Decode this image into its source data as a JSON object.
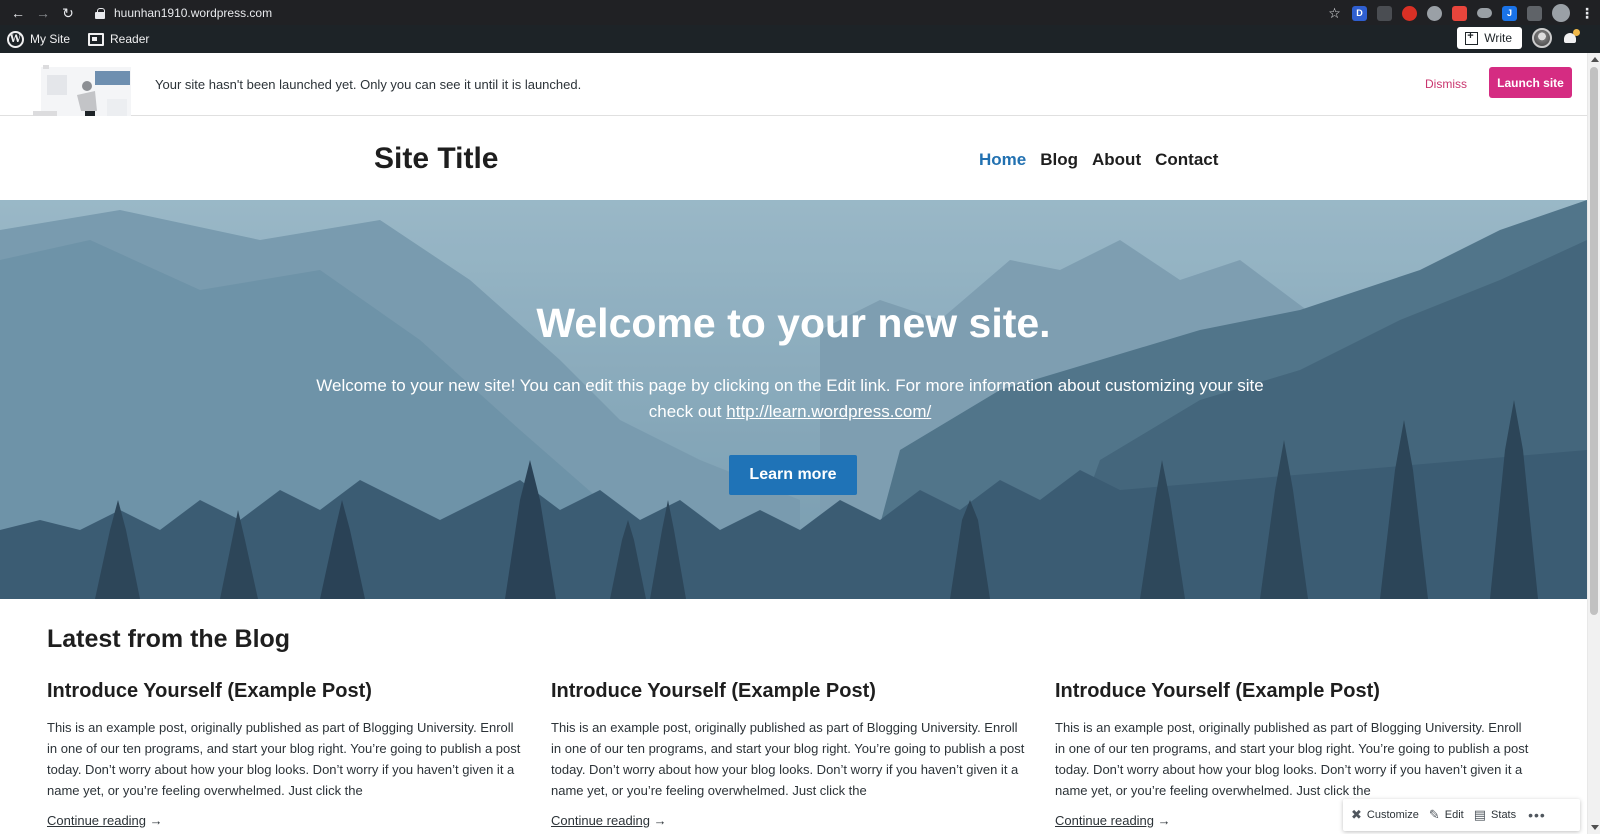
{
  "browser": {
    "url": "huunhan1910.wordpress.com",
    "extensions": [
      {
        "icon": "bookmark-star-icon"
      },
      {
        "icon": "extension-d-icon",
        "label": "D",
        "color": "#2f5fd0"
      },
      {
        "icon": "extension-grid-icon",
        "color": "#4a4d52"
      },
      {
        "icon": "extension-hand-icon",
        "color": "#d93025"
      },
      {
        "icon": "extension-swirl-icon",
        "color": "#9aa0a6"
      },
      {
        "icon": "extension-red-box-icon",
        "color": "#e8453c"
      },
      {
        "icon": "extension-pill-icon",
        "color": "#9aa0a6"
      },
      {
        "icon": "extension-j-icon",
        "label": "J",
        "color": "#1a73e8"
      },
      {
        "icon": "extension-chart-icon",
        "color": "#5f6368"
      }
    ]
  },
  "adminbar": {
    "my_site": "My Site",
    "reader": "Reader",
    "write": "Write"
  },
  "banner": {
    "message": "Your site hasn't been launched yet. Only you can see it until it is launched.",
    "dismiss": "Dismiss",
    "launch": "Launch site",
    "accent": "#d52c82"
  },
  "site": {
    "title": "Site Title",
    "nav": [
      {
        "label": "Home",
        "active": true
      },
      {
        "label": "Blog",
        "active": false
      },
      {
        "label": "About",
        "active": false
      },
      {
        "label": "Contact",
        "active": false
      }
    ]
  },
  "hero": {
    "title": "Welcome to your new site.",
    "text_before": "Welcome to your new site! You can edit this page by clicking on the Edit link. For more information about customizing your site check out ",
    "link": "http://learn.wordpress.com/",
    "button": "Learn more",
    "button_color": "#1f73b7"
  },
  "blog": {
    "heading": "Latest from the Blog",
    "posts": [
      {
        "title": "Introduce Yourself (Example Post)",
        "excerpt": "This is an example post, originally published as part of Blogging University. Enroll in one of our ten programs, and start your blog right. You’re going to publish a post today. Don’t worry about how your blog looks. Don’t worry if you haven’t given it a name yet, or you’re feeling overwhelmed. Just click the",
        "more": "Continue reading",
        "arrow": "→"
      },
      {
        "title": "Introduce Yourself (Example Post)",
        "excerpt": "This is an example post, originally published as part of Blogging University. Enroll in one of our ten programs, and start your blog right. You’re going to publish a post today. Don’t worry about how your blog looks. Don’t worry if you haven’t given it a name yet, or you’re feeling overwhelmed. Just click the",
        "more": "Continue reading",
        "arrow": "→"
      },
      {
        "title": "Introduce Yourself (Example Post)",
        "excerpt": "This is an example post, originally published as part of Blogging University. Enroll in one of our ten programs, and start your blog right. You’re going to publish a post today. Don’t worry about how your blog looks. Don’t worry if you haven’t given it a name yet, or you’re feeling overwhelmed. Just click the",
        "more": "Continue reading",
        "arrow": "→"
      }
    ]
  },
  "actions": {
    "customize": "Customize",
    "edit": "Edit",
    "stats": "Stats",
    "more": "•••"
  }
}
